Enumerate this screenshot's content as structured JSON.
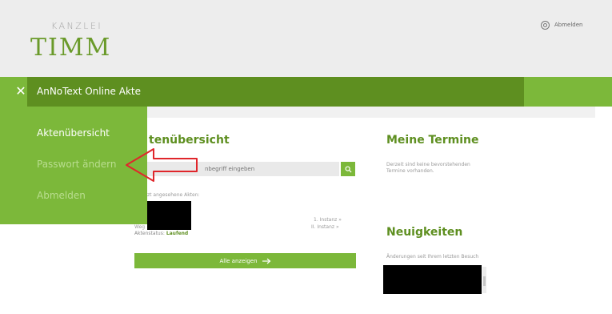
{
  "header": {
    "logo_top": "KANZLEI",
    "logo_main": "TIMM",
    "logout": "Abmelden"
  },
  "bar": {
    "close_icon": "close-icon",
    "title": "AnNoText Online Akte"
  },
  "side_menu": {
    "items": [
      {
        "label": "Aktenübersicht"
      },
      {
        "label": "Passwort ändern"
      },
      {
        "label": "Abmelden"
      }
    ]
  },
  "main": {
    "files_title": "tenübersicht",
    "search_placeholder": "nbegriff eingeben",
    "recent_label": "zt angesehene Akten:",
    "ref1": "1. Instanz »",
    "ref2": "II. Instanz »",
    "status_cut": "Weg",
    "status_label": "Aktenstatus:",
    "status_value": "Laufend",
    "all_button": "Alle anzeigen"
  },
  "termine": {
    "title": "Meine Termine",
    "text": "Derzeit sind keine bevorstehenden Termine vorhanden."
  },
  "news": {
    "title": "Neuigkeiten",
    "text": "Änderungen seit Ihrem letzten Besuch"
  },
  "colors": {
    "accent": "#7cb83a",
    "accent_dark": "#5e8f20",
    "annotation": "#e0262b"
  }
}
